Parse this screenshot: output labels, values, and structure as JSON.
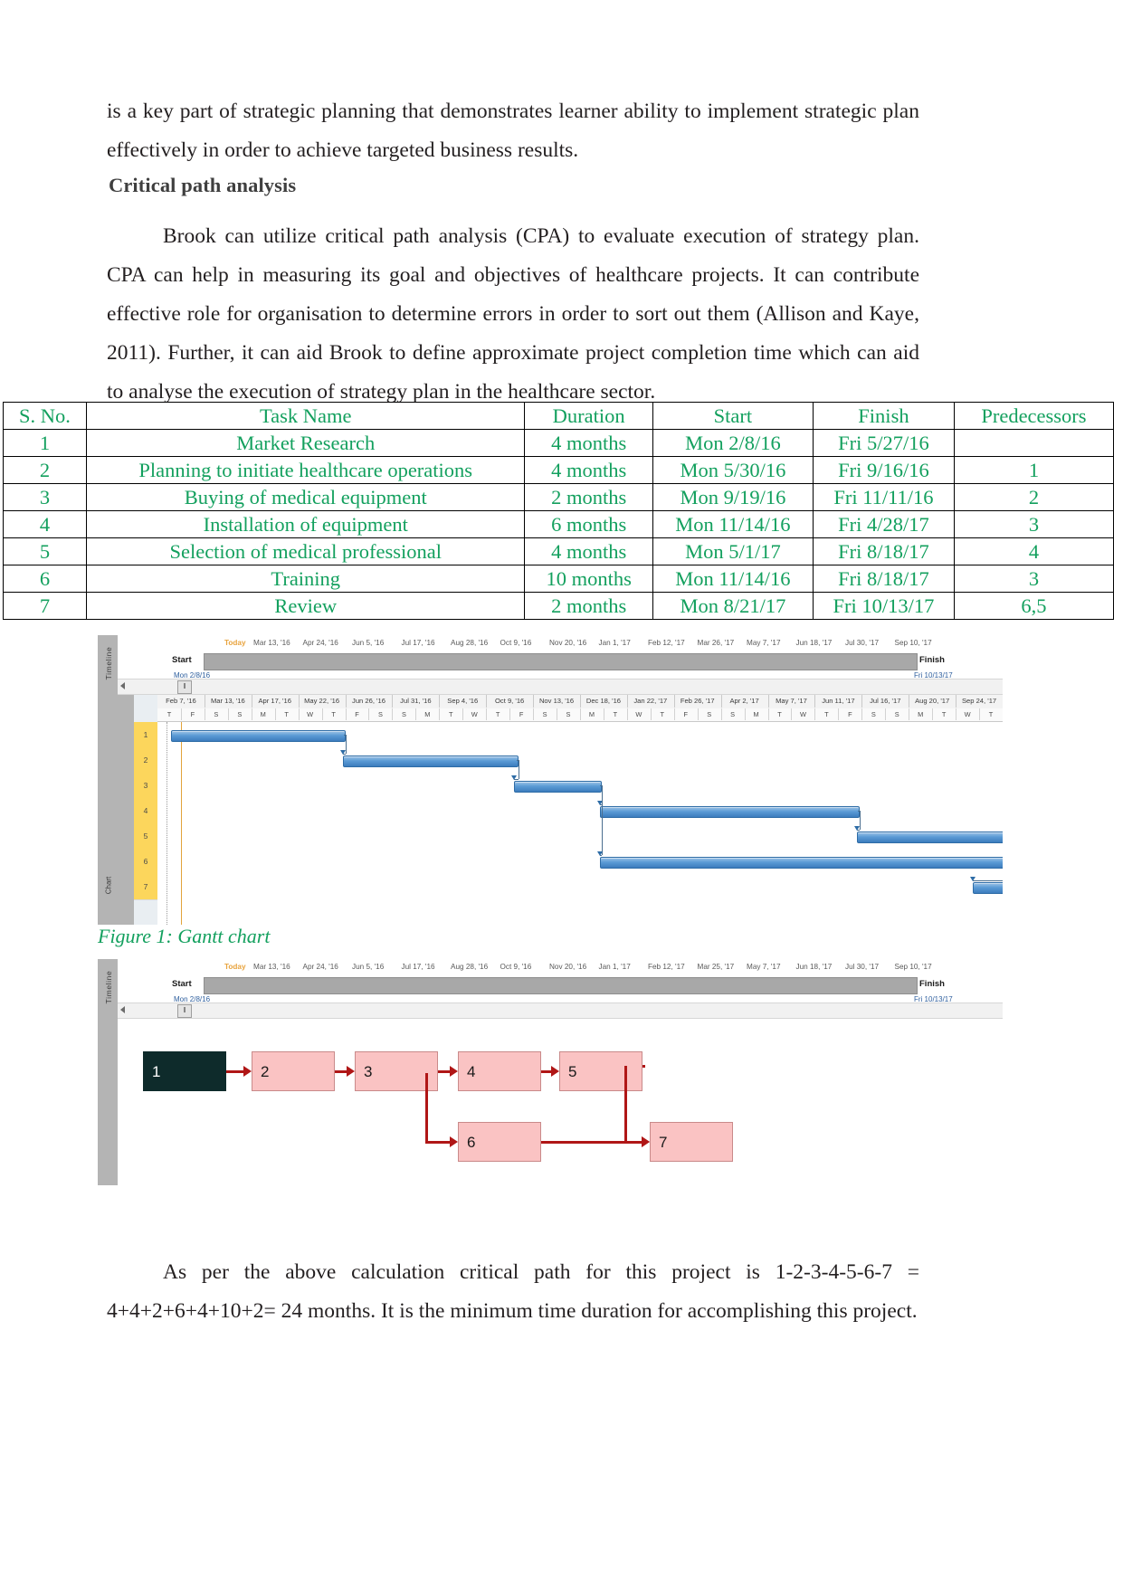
{
  "document": {
    "top_paragraph": "is a key part of strategic planning that demonstrates learner ability to implement strategic plan effectively in order to achieve targeted business results.",
    "heading": "Critical path analysis",
    "cpa_paragraph": "Brook can utilize critical path analysis (CPA) to evaluate execution of strategy plan. CPA can help in measuring its goal and objectives of healthcare projects.  It can  contribute effective role for organisation to determine errors in order to sort out them (Allison and Kaye, 2011). Further,  it can aid Brook to define approximate project completion time which can aid to analyse the execution of strategy plan in the healthcare sector.",
    "figure1_caption": "Figure 1: Gantt chart",
    "bottom_paragraph": "As per the above calculation critical path for this project is 1-2-3-4-5-6-7 = 4+4+2+6+4+10+2= 24 months. It is the minimum time duration for accomplishing this project.",
    "text_color": "#231f20",
    "accent_green": "#13a05e"
  },
  "chart_data": {
    "type": "table",
    "title": "Critical path analysis task schedule",
    "columns": [
      "S. No.",
      "Task Name",
      "Duration",
      "Start",
      "Finish",
      "Predecessors"
    ],
    "rows": [
      [
        "1",
        "Market Research",
        "4 months",
        "Mon 2/8/16",
        "Fri 5/27/16",
        ""
      ],
      [
        "2",
        "Planning to initiate healthcare operations",
        "4 months",
        "Mon 5/30/16",
        "Fri 9/16/16",
        "1"
      ],
      [
        "3",
        "Buying of medical equipment",
        "2 months",
        "Mon 9/19/16",
        "Fri 11/11/16",
        "2"
      ],
      [
        "4",
        "Installation of equipment",
        "6 months",
        "Mon 11/14/16",
        "Fri 4/28/17",
        "3"
      ],
      [
        "5",
        "Selection of medical professional",
        "4 months",
        "Mon 5/1/17",
        "Fri 8/18/17",
        "4"
      ],
      [
        "6",
        "Training",
        "10 months",
        "Mon 11/14/16",
        "Fri 8/18/17",
        "3"
      ],
      [
        "7",
        "Review",
        "2 months",
        "Mon 8/21/17",
        "Fri 10/13/17",
        "6,5"
      ]
    ]
  },
  "gantt": {
    "rail_label": "Timeline",
    "rail_label_2": "Chart",
    "today_label": "Today",
    "start_label": "Start",
    "start_date": "Mon 2/8/16",
    "finish_label": "Finish",
    "finish_date": "Fri 10/13/17",
    "timeline_dates": [
      "Mar 13, '16",
      "Apr 24, '16",
      "Jun 5, '16",
      "Jul 17, '16",
      "Aug 28, '16",
      "Oct 9, '16",
      "Nov 20, '16",
      "Jan 1, '17",
      "Feb 12, '17",
      "Mar 26, '17",
      "May 7, '17",
      "Jun 18, '17",
      "Jul 30, '17",
      "Sep 10, '17"
    ],
    "date_headers": [
      "Feb 7, '16",
      "Mar 13, '16",
      "Apr 17, '16",
      "May 22, '16",
      "Jun 26, '16",
      "Jul 31, '16",
      "Sep 4, '16",
      "Oct 9, '16",
      "Nov 13, '16",
      "Dec 18, '16",
      "Jan 22, '17",
      "Feb 26, '17",
      "Apr 2, '17",
      "May 7, '17",
      "Jun 11, '17",
      "Jul 16, '17",
      "Aug 20, '17",
      "Sep 24, '17"
    ],
    "day_headers": [
      "T",
      "F",
      "S",
      "S",
      "M",
      "T",
      "W",
      "T",
      "F",
      "S",
      "S",
      "M",
      "T",
      "W",
      "T",
      "F",
      "S",
      "S",
      "M",
      "T",
      "W",
      "T",
      "F",
      "S",
      "S",
      "M",
      "T",
      "W",
      "T",
      "F",
      "S",
      "S",
      "M",
      "T",
      "W",
      "T"
    ],
    "row_ids": [
      "1",
      "2",
      "3",
      "4",
      "5",
      "6",
      "7"
    ],
    "bars": [
      {
        "id": "1",
        "start_pct": 1.6,
        "width_pct": 20.5,
        "row": 0
      },
      {
        "id": "2",
        "start_pct": 22.0,
        "width_pct": 20.5,
        "row": 1
      },
      {
        "id": "3",
        "start_pct": 42.2,
        "width_pct": 10.2,
        "row": 2
      },
      {
        "id": "4",
        "start_pct": 52.4,
        "width_pct": 30.5,
        "row": 3
      },
      {
        "id": "5",
        "start_pct": 82.8,
        "width_pct": 20.5,
        "row": 4
      },
      {
        "id": "6",
        "start_pct": 52.4,
        "width_pct": 50.0,
        "row": 5
      },
      {
        "id": "7",
        "start_pct": 96.5,
        "width_pct": 10.2,
        "row": 6
      }
    ],
    "bar_color": "#5b9bd5",
    "id_cell_color": "#fcd65c"
  },
  "network": {
    "rail_label": "Timeline",
    "today_label": "Today",
    "start_label": "Start",
    "start_date": "Mon 2/8/16",
    "finish_label": "Finish",
    "finish_date": "Fri 10/13/17",
    "timeline_dates": [
      "Mar 13, '16",
      "Apr 24, '16",
      "Jun 5, '16",
      "Jul 17, '16",
      "Aug 28, '16",
      "Oct 9, '16",
      "Nov 20, '16",
      "Jan 1, '17",
      "Feb 12, '17",
      "Mar 25, '17",
      "May 7, '17",
      "Jun 18, '17",
      "Jul 30, '17",
      "Sep 10, '17"
    ],
    "nodes": [
      {
        "label": "1",
        "critical": true
      },
      {
        "label": "2",
        "critical": false
      },
      {
        "label": "3",
        "critical": false
      },
      {
        "label": "4",
        "critical": false
      },
      {
        "label": "5",
        "critical": false
      },
      {
        "label": "6",
        "critical": false
      },
      {
        "label": "7",
        "critical": false
      }
    ],
    "node_color": "#fac3c3",
    "critical_node_color": "#0e2b2b",
    "arrow_color": "#b01616"
  }
}
